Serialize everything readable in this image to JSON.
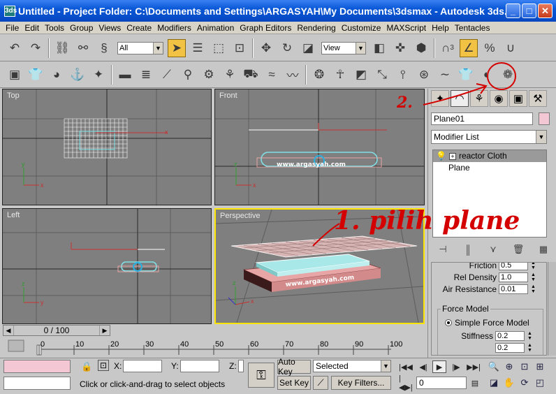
{
  "window": {
    "app_icon": "3ds",
    "title": "Untitled      - Project Folder: C:\\Documents and Settings\\ARGASYAH\\My Documents\\3dsmax    - Autodesk 3ds...",
    "minimize_icon": "minimize-icon",
    "maximize_icon": "maximize-icon",
    "close_icon": "close-icon"
  },
  "menu": [
    "File",
    "Edit",
    "Tools",
    "Group",
    "Views",
    "Create",
    "Modifiers",
    "Animation",
    "Graph Editors",
    "Rendering",
    "Customize",
    "MAXScript",
    "Help",
    "Tentacles"
  ],
  "main_toolbar": {
    "selection_filter": "All",
    "reference_coord": "View",
    "snap_label": "3"
  },
  "viewports": {
    "top": "Top",
    "front": "Front",
    "left": "Left",
    "perspective": "Perspective",
    "watermark": "www.argasyah.com",
    "axis_x": "x",
    "axis_y": "y",
    "axis_z": "z"
  },
  "command_panel": {
    "object_name": "Plane01",
    "object_color": "#f3c7d3",
    "modifier_list": "Modifier List",
    "stack": [
      {
        "label": "reactor Cloth",
        "expand": "+"
      },
      {
        "label": "Plane"
      }
    ],
    "params": {
      "friction_label": "Friction",
      "friction_value": "0.5",
      "rel_density_label": "Rel Density",
      "rel_density_value": "1.0",
      "air_resistance_label": "Air Resistance",
      "air_resistance_value": "0.01",
      "force_model_title": "Force Model",
      "simple_force_model": "Simple Force Model",
      "stiffness_label": "Stiffness",
      "stiffness_value": "0.2",
      "damping_value": "0.2"
    }
  },
  "timeline": {
    "frame_display": "0 / 100",
    "ticks": [
      "0",
      "10",
      "20",
      "30",
      "40",
      "50",
      "60",
      "70",
      "80",
      "90",
      "100"
    ]
  },
  "status": {
    "x_label": "X:",
    "y_label": "Y:",
    "z_label": "Z:",
    "auto_key": "Auto Key",
    "set_key": "Set Key",
    "key_filter_select": "Selected",
    "key_filters": "Key Filters...",
    "current_frame": "0",
    "prompt": "Click or click-and-drag to select objects"
  },
  "annotations": {
    "step1": "1. pilih plane",
    "step2": "2.",
    "color": "#d40000"
  }
}
